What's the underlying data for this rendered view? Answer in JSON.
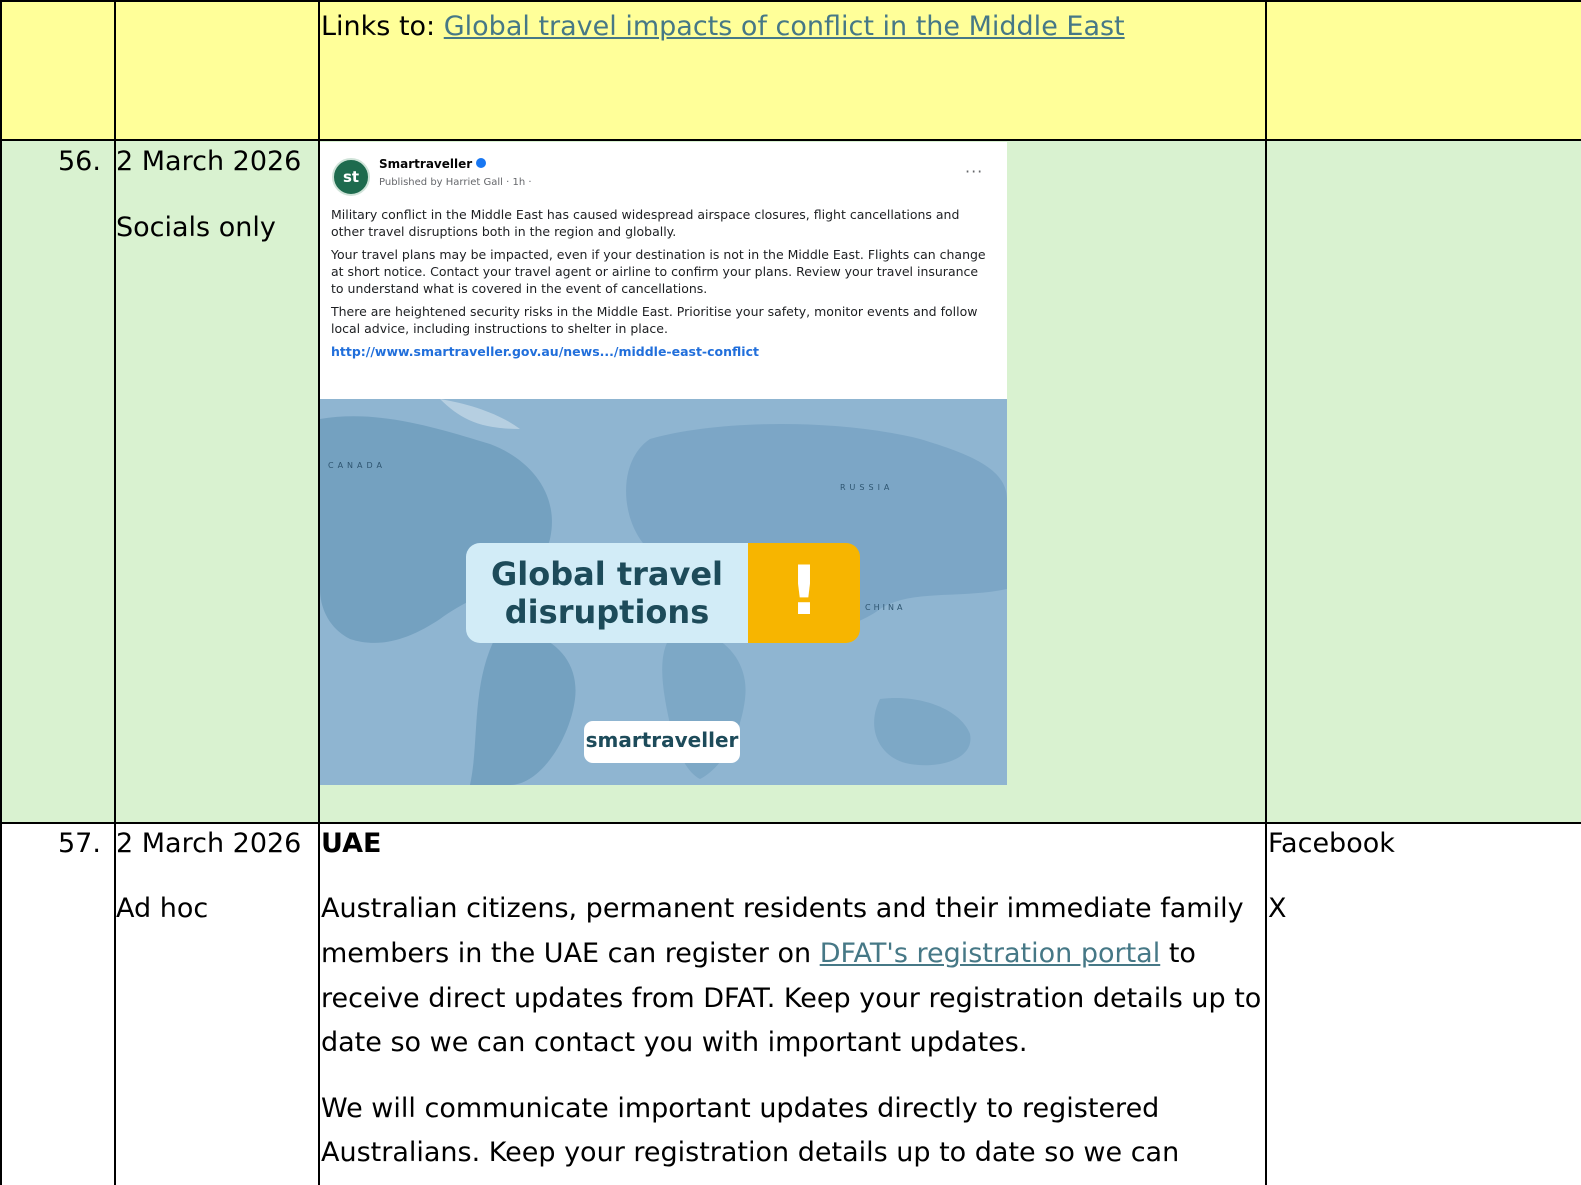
{
  "rows": [
    {
      "number": "",
      "date": "",
      "type": "",
      "content": {
        "links_prefix": "Links to: ",
        "links_text": "Global travel impacts of conflict in the Middle East"
      },
      "channels": []
    },
    {
      "number": "56.",
      "date": "2 March 2026",
      "type": "Socials only",
      "post": {
        "page_name": "Smartraveller",
        "avatar_text": "st",
        "meta": "Published by Harriet Gall · 1h ·",
        "more": "···",
        "paragraphs": [
          "Military conflict in the Middle East has caused widespread airspace closures, flight cancellations and other travel disruptions both in the region and globally.",
          "Your travel plans may be impacted, even if your destination is not in the Middle East. Flights can change at short notice. Contact your travel agent or airline to confirm your plans. Review your travel insurance to understand what is covered in the event of cancellations.",
          "There are heightened security risks in the Middle East. Prioritise your safety, monitor events and follow local advice, including instructions to shelter in place."
        ],
        "link": "http://www.smartraveller.gov.au/news.../middle-east-conflict",
        "image": {
          "line1": "Global travel",
          "line2": "disruptions",
          "alert_glyph": "!",
          "logo_text": "smartraveller",
          "map_labels": [
            "CANADA",
            "RUSSIA",
            "CHINA"
          ]
        }
      },
      "channels": []
    },
    {
      "number": "57.",
      "date": "2 March 2026",
      "type": "Ad hoc",
      "content": {
        "heading": "UAE",
        "para1_line1": "Australian citizens, permanent residents and their immediate family",
        "para1_line2_prefix": "members in the UAE can register on ",
        "para1_link": "DFAT's registration portal",
        "para1_line2_suffix": " to",
        "para1_line3": "receive direct updates from DFAT. Keep your registration details up to",
        "para1_line4": "date so we can contact you with important updates.",
        "para2_line1": "We will communicate important updates directly to registered",
        "para2_line2": "Australians. Keep your registration details up to date so we can"
      },
      "channels": [
        "Facebook",
        "X"
      ]
    }
  ],
  "colors": {
    "yellow_row": "#ffff99",
    "green_row": "#d9f2d0",
    "link": "#467886",
    "banner_orange": "#f7b500"
  }
}
